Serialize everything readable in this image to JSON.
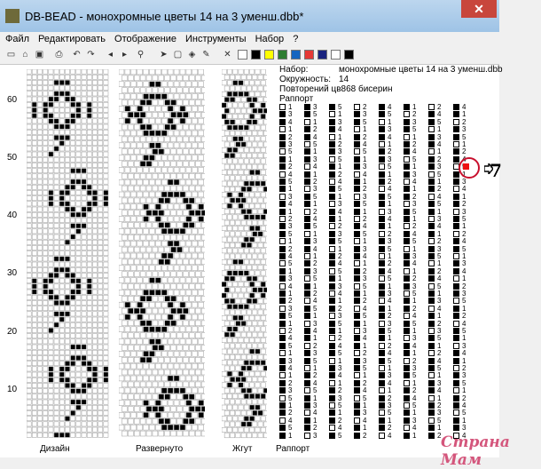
{
  "window": {
    "title": "DB-BEAD - монохромные цветы 14 на 3 уменш.dbb*",
    "close": "✕"
  },
  "menu": {
    "items": [
      "Файл",
      "Редактировать",
      "Отображение",
      "Инструменты",
      "Набор",
      "?"
    ]
  },
  "palette": {
    "colors": [
      "#ffffff",
      "#000000",
      "#ffff00",
      "#2e7d32",
      "#1565c0",
      "#e53935",
      "#1a237e",
      "#ffffff",
      "#000000"
    ]
  },
  "ruler": {
    "labels": [
      "60",
      "50",
      "40",
      "30",
      "20",
      "10"
    ]
  },
  "captions": {
    "design": "Дизайн",
    "unrolled": "Развернуто",
    "harness": "Жгут",
    "rapport": "Раппорт"
  },
  "info": {
    "set_label": "Набор:",
    "set_value": "монохромные цветы 14 на 3 уменш.dbb",
    "circ_label": "Окружность:",
    "circ_value": "14",
    "repeat_text": "Повторений цв868 бисерин",
    "rapport_label": "Раппорт"
  },
  "annotation": {
    "label": "7"
  },
  "watermark": "Страна Мам"
}
